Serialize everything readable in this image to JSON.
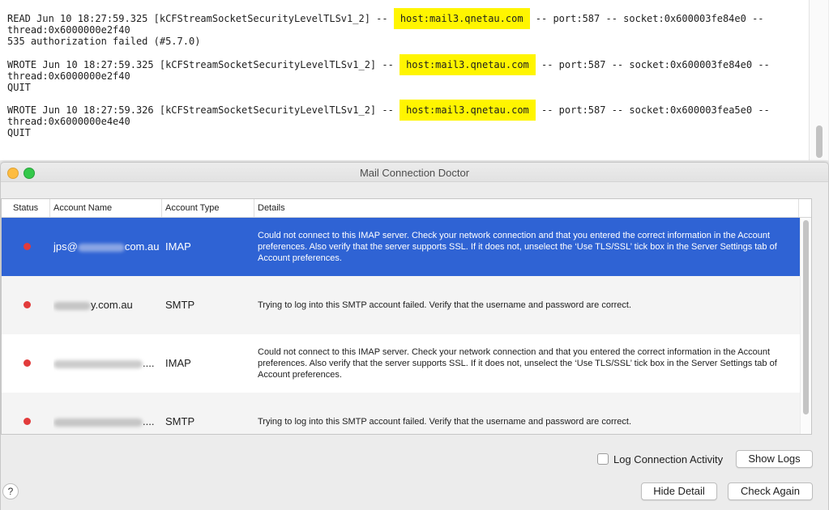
{
  "log": {
    "entries": [
      {
        "line1_pre": "READ Jun 10 18:27:59.325 [kCFStreamSocketSecurityLevelTLSv1_2] -- ",
        "host": "host:mail3.qnetau.com",
        "line1_post": " -- port:587 -- socket:0x600003fe84e0 --",
        "line2": "thread:0x6000000e2f40",
        "line3": "535 authorization failed (#5.7.0)"
      },
      {
        "line1_pre": "WROTE Jun 10 18:27:59.325 [kCFStreamSocketSecurityLevelTLSv1_2] -- ",
        "host": "host:mail3.qnetau.com",
        "line1_post": " -- port:587 -- socket:0x600003fe84e0 --",
        "line2": "thread:0x6000000e2f40",
        "line3": "QUIT"
      },
      {
        "line1_pre": "WROTE Jun 10 18:27:59.326 [kCFStreamSocketSecurityLevelTLSv1_2] -- ",
        "host": "host:mail3.qnetau.com",
        "line1_post": " -- port:587 -- socket:0x600003fea5e0 --",
        "line2": "thread:0x6000000e4e40",
        "line3": "QUIT"
      }
    ]
  },
  "window": {
    "title": "Mail Connection Doctor"
  },
  "table": {
    "headers": {
      "status": "Status",
      "account_name": "Account Name",
      "account_type": "Account Type",
      "details": "Details"
    },
    "rows": [
      {
        "name_prefix": "jps@",
        "name_suffix": "com.au",
        "type": "IMAP",
        "details": "Could not connect to this IMAP server. Check your network connection and that you entered the correct information in the Account preferences. Also verify that the server supports SSL. If it does not, unselect the ‘Use TLS/SSL’ tick box in the Server Settings tab of Account preferences."
      },
      {
        "name_prefix": "",
        "name_suffix": "y.com.au",
        "type": "SMTP",
        "details": "Trying to log into this SMTP account failed. Verify that the username and password are correct."
      },
      {
        "name_prefix": "",
        "name_suffix": "....",
        "type": "IMAP",
        "details": "Could not connect to this IMAP server. Check your network connection and that you entered the correct information in the Account preferences. Also verify that the server supports SSL. If it does not, unselect the ‘Use TLS/SSL’ tick box in the Server Settings tab of Account preferences."
      },
      {
        "name_prefix": "",
        "name_suffix": "....",
        "type": "SMTP",
        "details": "Trying to log into this SMTP account failed. Verify that the username and password are correct."
      }
    ]
  },
  "controls": {
    "log_activity_label": "Log Connection Activity",
    "log_activity_checked": false,
    "show_logs": "Show Logs",
    "hide_detail": "Hide Detail",
    "check_again": "Check Again",
    "help": "?"
  },
  "colors": {
    "highlight": "#fff500",
    "selection": "#2f63d4",
    "status_error": "#e23b3b"
  }
}
